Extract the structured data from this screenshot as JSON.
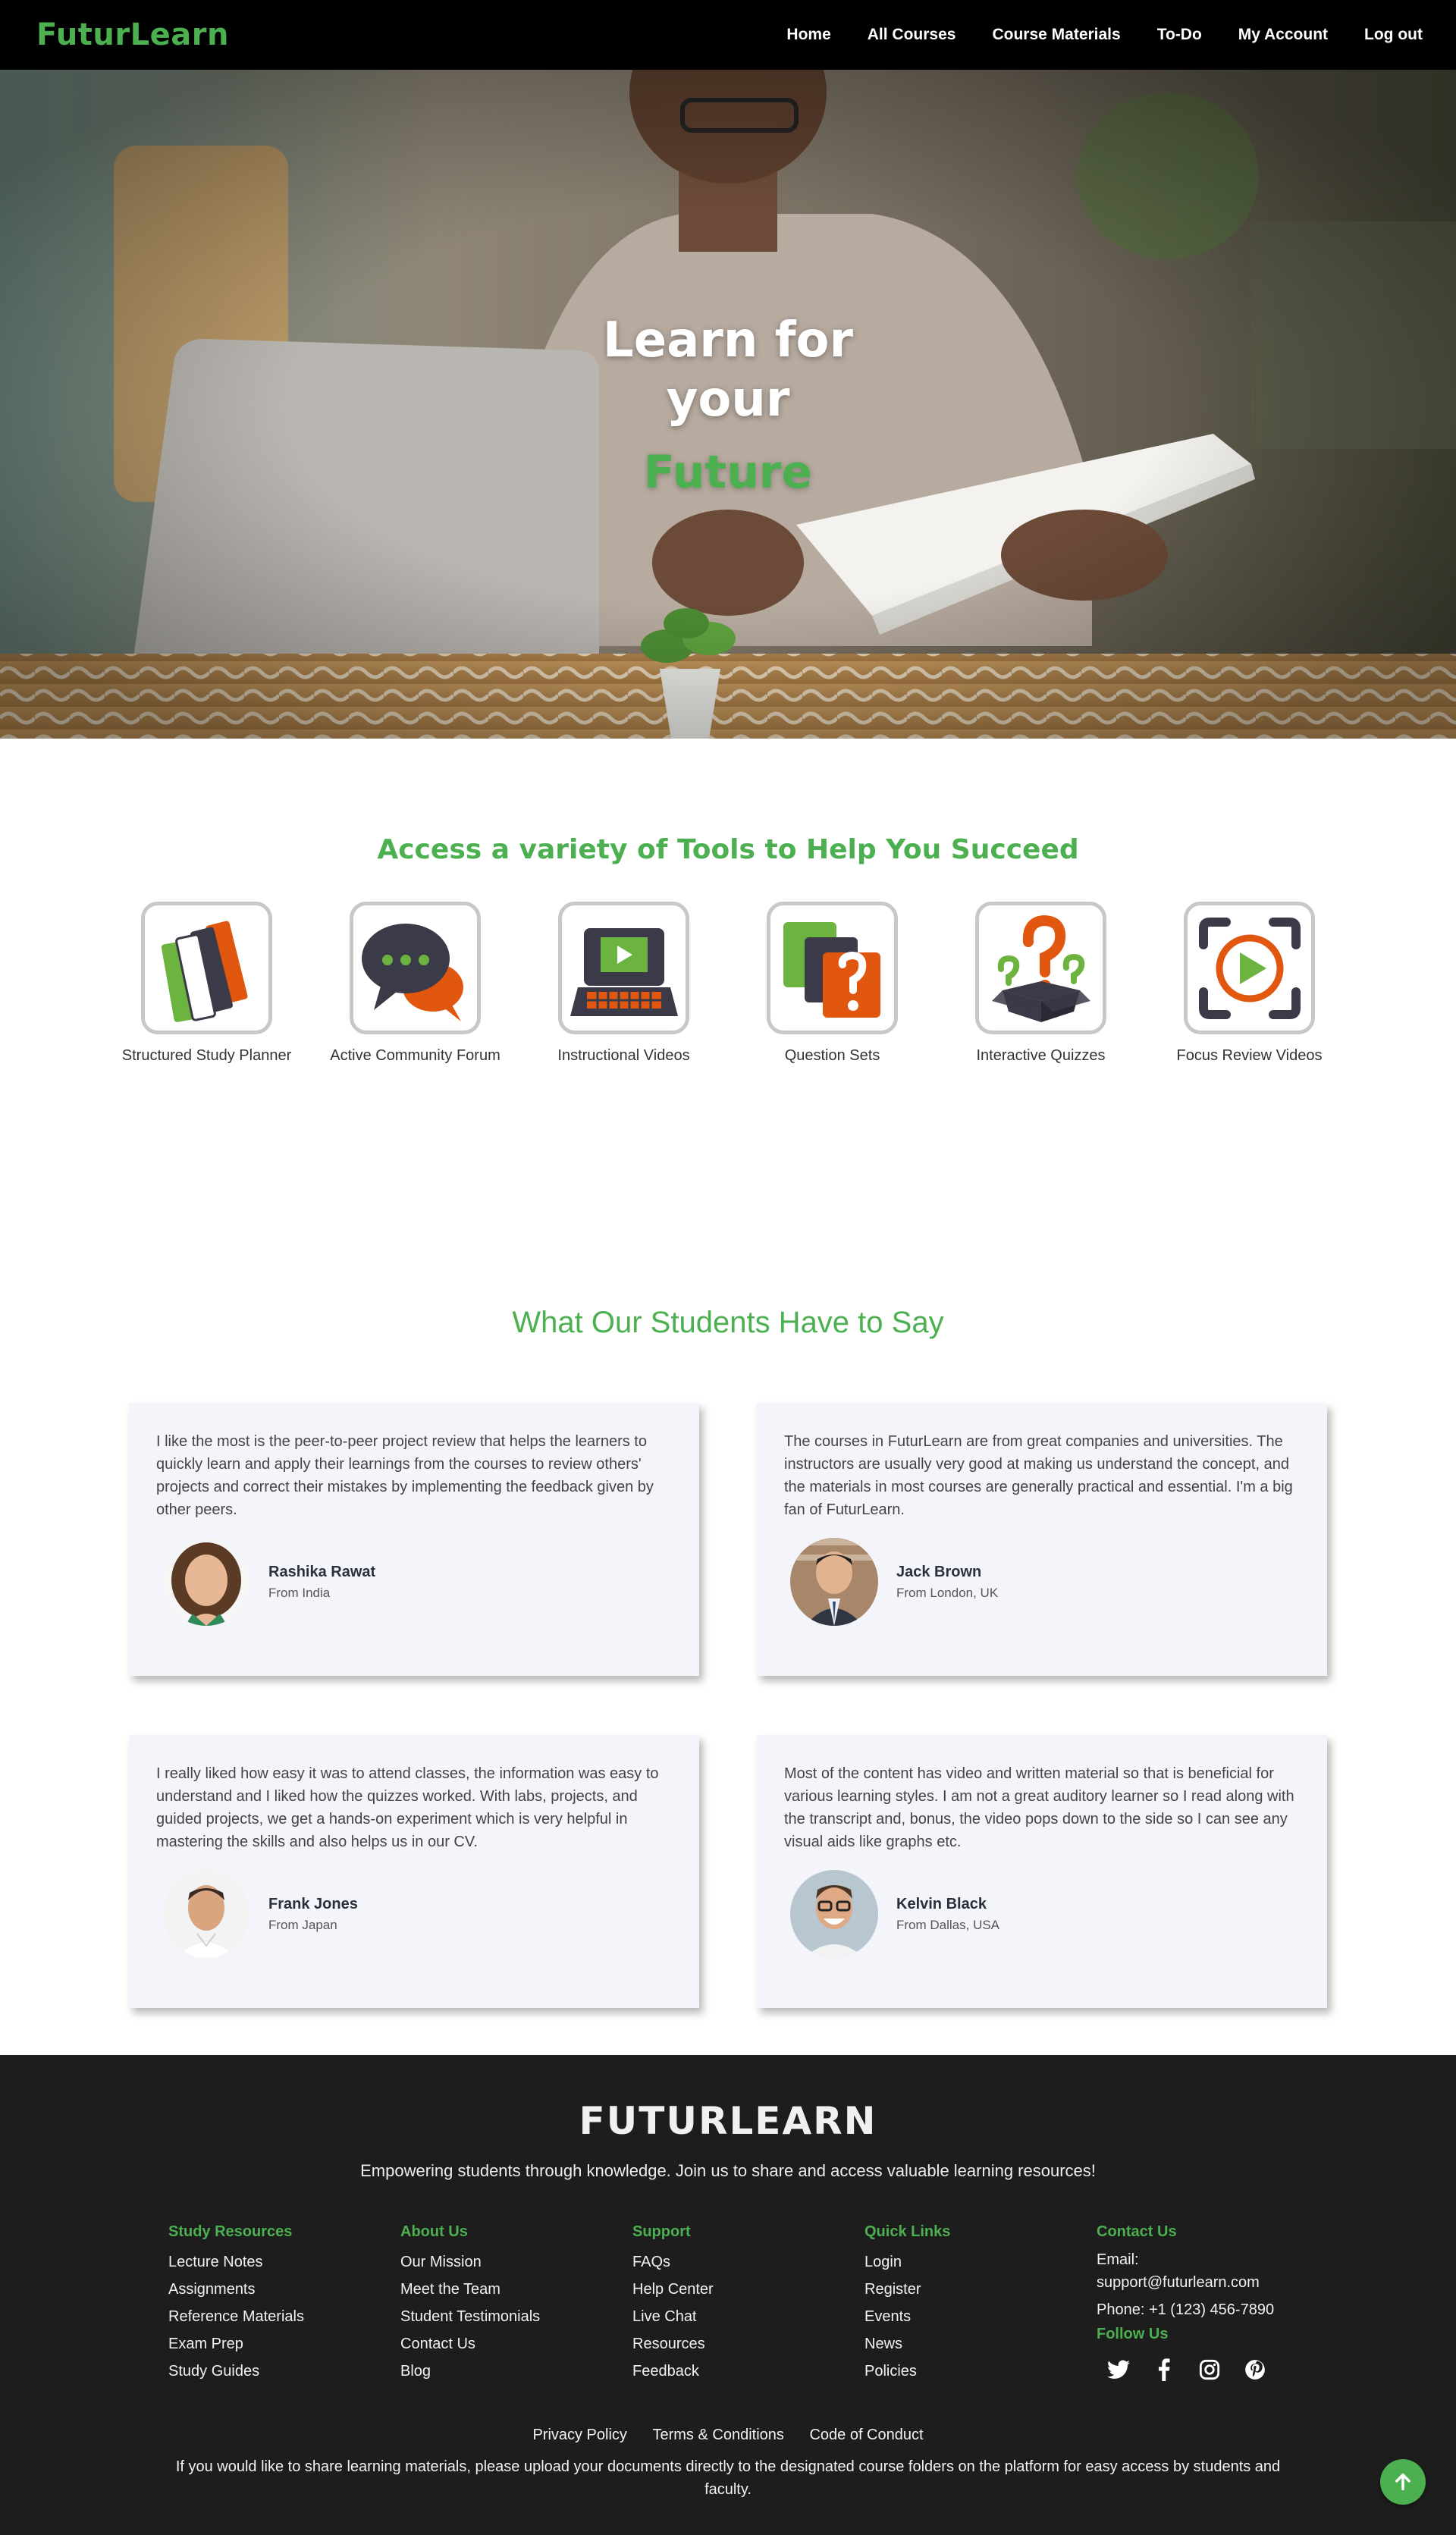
{
  "navbar": {
    "brand": "FuturLearn",
    "links": [
      "Home",
      "All Courses",
      "Course Materials",
      "To-Do",
      "My Account",
      "Log out"
    ]
  },
  "hero": {
    "line1": "Learn for",
    "line2": "your",
    "accent": "Future"
  },
  "tools": {
    "title": "Access a variety of Tools to Help You Succeed",
    "items": [
      {
        "label": "Structured Study Planner",
        "icon": "books-icon"
      },
      {
        "label": "Active Community Forum",
        "icon": "chat-bubbles-icon"
      },
      {
        "label": "Instructional Videos",
        "icon": "laptop-video-icon"
      },
      {
        "label": "Question Sets",
        "icon": "question-cards-icon"
      },
      {
        "label": "Interactive Quizzes",
        "icon": "question-box-icon"
      },
      {
        "label": "Focus Review Videos",
        "icon": "focus-play-icon"
      }
    ]
  },
  "testimonials": {
    "title": "What Our Students Have to Say",
    "items": [
      {
        "quote": "I like the most is the peer-to-peer project review that helps the learners to quickly learn and apply their learnings from the courses to review others' projects and correct their mistakes by implementing the feedback given by other peers.",
        "name": "Rashika Rawat",
        "from": "From India"
      },
      {
        "quote": "The courses in FuturLearn are from great companies and universities. The instructors are usually very good at making us understand the concept, and the materials in most courses are generally practical and essential. I'm a big fan of FuturLearn.",
        "name": "Jack Brown",
        "from": "From London, UK"
      },
      {
        "quote": "I really liked how easy it was to attend classes, the information was easy to understand and I liked how the quizzes worked. With labs, projects, and guided projects, we get a hands-on experiment which is very helpful in mastering the skills and also helps us in our CV.",
        "name": "Frank Jones",
        "from": "From Japan"
      },
      {
        "quote": "Most of the content has video and written material so that is beneficial for various learning styles. I am not a great auditory learner so I read along with the transcript and, bonus, the video pops down to the side so I can see any visual aids like graphs etc.",
        "name": "Kelvin Black",
        "from": "From Dallas, USA"
      }
    ]
  },
  "footer": {
    "brand": "FUTURLEARN",
    "tagline": "Empowering students through knowledge. Join us to share and access valuable learning resources!",
    "columns": [
      {
        "title": "Study Resources",
        "items": [
          "Lecture Notes",
          "Assignments",
          "Reference Materials",
          "Exam Prep",
          "Study Guides"
        ]
      },
      {
        "title": "About Us",
        "items": [
          "Our Mission",
          "Meet the Team",
          "Student Testimonials",
          "Contact Us",
          "Blog"
        ]
      },
      {
        "title": "Support",
        "items": [
          "FAQs",
          "Help Center",
          "Live Chat",
          "Resources",
          "Feedback"
        ]
      },
      {
        "title": "Quick Links",
        "items": [
          "Login",
          "Register",
          "Events",
          "News",
          "Policies"
        ]
      }
    ],
    "contact": {
      "title": "Contact Us",
      "email_label": "Email:",
      "email": "support@futurlearn.com",
      "phone": "Phone: +1 (123) 456-7890",
      "follow_title": "Follow Us",
      "socials": [
        "twitter-icon",
        "facebook-icon",
        "instagram-icon",
        "pinterest-icon"
      ]
    },
    "legal_links": [
      "Privacy Policy",
      "Terms & Conditions",
      "Code of Conduct"
    ],
    "note": "If you would like to share learning materials, please upload your documents directly to the designated course folders on the platform for easy access by students and faculty."
  },
  "colors": {
    "accent": "#4caf50",
    "navbar": "#000000",
    "footer": "#1d1d1d",
    "card": "#f4f5fb",
    "orange": "#e2570f",
    "dark_icon": "#3a3a48"
  }
}
